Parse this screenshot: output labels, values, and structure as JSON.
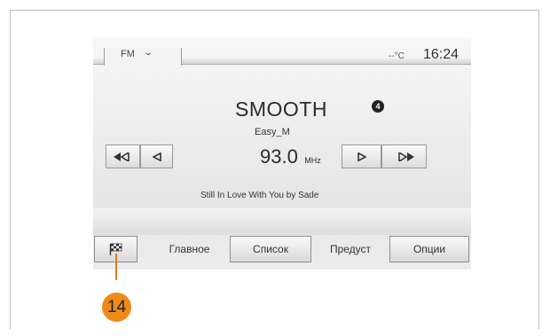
{
  "header": {
    "band_label": "FM",
    "temperature": "--°C",
    "time": "16:24"
  },
  "radio": {
    "station_name": "SMOOTH",
    "preset_number": "4",
    "rds_text": "Easy_M",
    "frequency": "93.0",
    "frequency_unit": "MHz",
    "now_playing": "Still In Love With You by Sade"
  },
  "tabs": {
    "icon": "checkered-flag-icon",
    "main": "Главное",
    "list": "Список",
    "presets": "Предуст",
    "options": "Опции"
  },
  "callout": {
    "number": "14",
    "color": "#ef8a1a"
  },
  "icons": {
    "fast_rewind": "fast-rewind-icon",
    "step_back": "step-back-icon",
    "step_forward": "step-forward-icon",
    "fast_forward": "fast-forward-icon",
    "band_dropdown": "chevron-down-icon"
  }
}
